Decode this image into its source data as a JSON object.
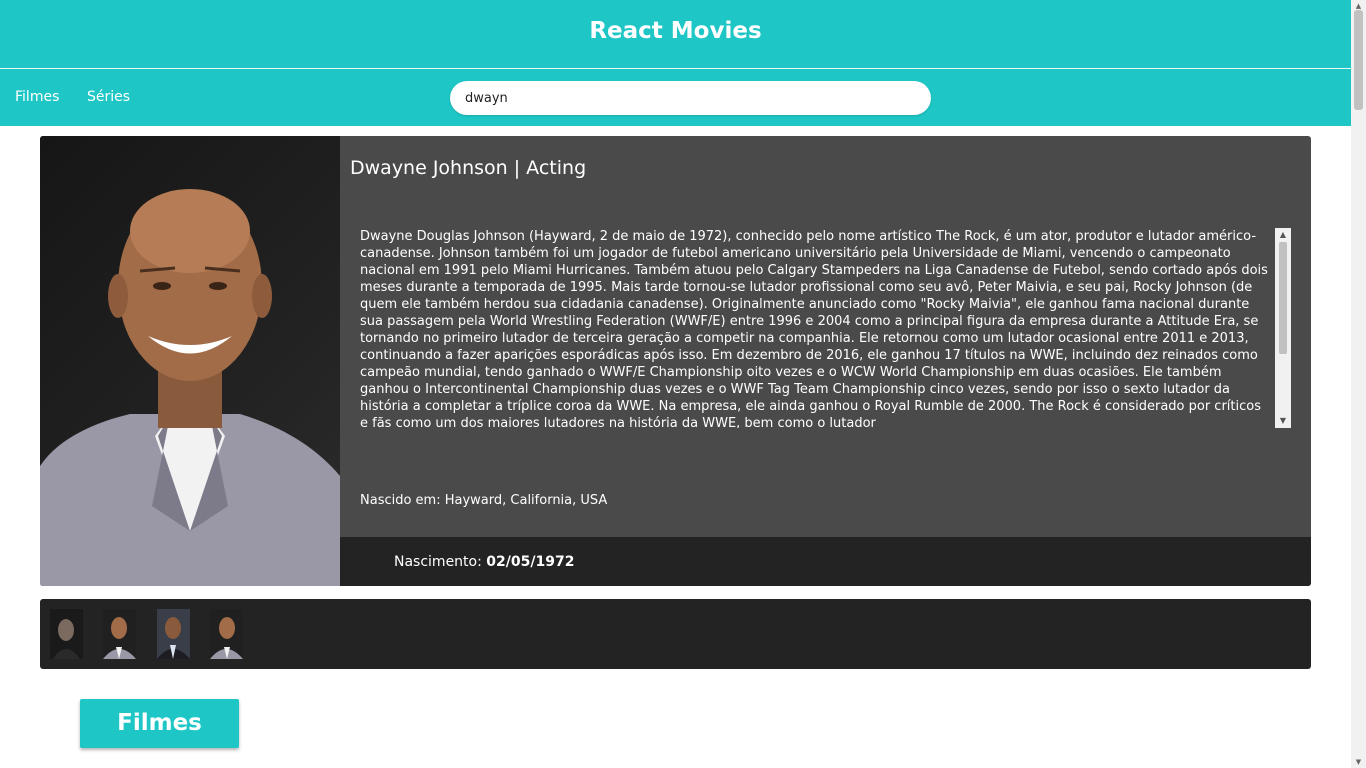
{
  "header": {
    "title": "React Movies"
  },
  "nav": {
    "links": [
      {
        "label": "Filmes"
      },
      {
        "label": "Séries"
      }
    ],
    "search": {
      "value": "dwayn",
      "placeholder": ""
    }
  },
  "person": {
    "heading": "Dwayne Johnson | Acting",
    "biography": "Dwayne Douglas Johnson (Hayward, 2 de maio de 1972), conhecido pelo nome artístico The Rock, é um ator, produtor e lutador américo-canadense. Johnson também foi um jogador de futebol americano universitário pela Universidade de Miami, vencendo o campeonato nacional em 1991 pelo Miami Hurricanes. Também atuou pelo Calgary Stampeders na Liga Canadense de Futebol, sendo cortado após dois meses durante a temporada de 1995. Mais tarde tornou-se lutador profissional como seu avô, Peter Maivia, e seu pai, Rocky Johnson (de quem ele também herdou sua cidadania canadense). Originalmente anunciado como \"Rocky Maivia\", ele ganhou fama nacional durante sua passagem pela World Wrestling Federation (WWF/E) entre 1996 e 2004 como a principal figura da empresa durante a Attitude Era, se tornando no primeiro lutador de terceira geração a competir na companhia. Ele retornou como um lutador ocasional entre 2011 e 2013, continuando a fazer aparições esporádicas após isso. Em dezembro de 2016, ele ganhou 17 títulos na WWE, incluindo dez reinados como campeão mundial, tendo ganhado o WWF/E Championship oito vezes e o WCW World Championship em duas ocasiões. Ele também ganhou o Intercontinental Championship duas vezes e o WWF Tag Team Championship cinco vezes, sendo por isso o sexto lutador da história a completar a tríplice coroa da WWE. Na empresa, ele ainda ganhou o Royal Rumble de 2000. The Rock é considerado por críticos e fãs como um dos maiores lutadores na história da WWE, bem como o lutador",
    "birthplace": "Nascido em: Hayward, California, USA",
    "birth_label": "Nascimento:",
    "birth_date": "02/05/1972"
  },
  "gallery": {
    "count": 4
  },
  "section_tab": {
    "label": "Filmes"
  },
  "colors": {
    "accent": "#1fc6c6",
    "card": "#4a4a4a",
    "dark": "#232323"
  }
}
